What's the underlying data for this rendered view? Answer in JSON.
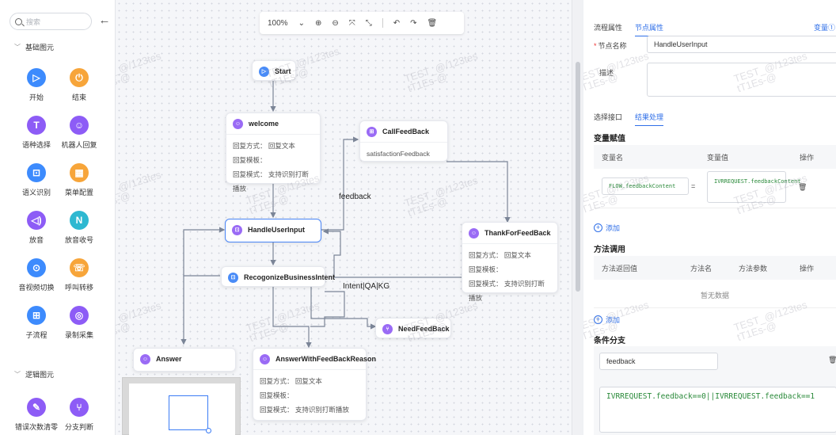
{
  "palette": {
    "search_placeholder": "搜索",
    "section_basic": "基础图元",
    "section_logic": "逻辑图元",
    "items": [
      {
        "label": "开始",
        "icon": "play-icon"
      },
      {
        "label": "结束",
        "icon": "power-icon"
      },
      {
        "label": "语种选择",
        "icon": "text-T-icon"
      },
      {
        "label": "机器人回复",
        "icon": "robot-icon"
      },
      {
        "label": "语义识别",
        "icon": "scan-face-icon"
      },
      {
        "label": "菜单配置",
        "icon": "grid-menu-icon"
      },
      {
        "label": "放音",
        "icon": "speaker-icon"
      },
      {
        "label": "放音收号",
        "icon": "keypad-icon"
      },
      {
        "label": "音视频切换",
        "icon": "av-switch-icon"
      },
      {
        "label": "呼叫转移",
        "icon": "call-transfer-icon"
      },
      {
        "label": "子流程",
        "icon": "subflow-icon"
      },
      {
        "label": "录制采集",
        "icon": "record-icon"
      },
      {
        "label": "错误次数清零",
        "icon": "eraser-icon"
      },
      {
        "label": "分支判断",
        "icon": "branch-icon"
      }
    ]
  },
  "toolbar": {
    "zoom": "100%"
  },
  "nodes": {
    "start": "Start",
    "welcome": {
      "title": "welcome",
      "lines": [
        "回复方式：  回复文本",
        "回复模板：",
        "回复模式：  支持识别打断播放"
      ]
    },
    "callfeedback": {
      "title": "CallFeedBack",
      "body": "satisfactionFeedback"
    },
    "handleuserinput": "HandleUserInput",
    "thankforfeedback": {
      "title": "ThankForFeedBack",
      "lines": [
        "回复方式：  回复文本",
        "回复模板：",
        "回复模式：  支持识别打断播放"
      ]
    },
    "recognize": "RecogonizeBusinessIntent",
    "needfeedback": "NeedFeedBack",
    "answer": "Answer",
    "answerwithfeedback": {
      "title": "AnswerWithFeedBackReason",
      "lines": [
        "回复方式：  回复文本",
        "回复模板：",
        "回复模式：  支持识别打断播放"
      ]
    }
  },
  "edge_labels": {
    "feedback": "feedback",
    "intent": "Intent|QA|KG"
  },
  "watermark": "TEST_@/123tes\ntT1Es-@",
  "panel": {
    "tabs": [
      "流程属性",
      "节点属性"
    ],
    "active_tab": "节点属性",
    "top_right": "变量①",
    "node_name_label": "节点名称",
    "node_name_value": "HandleUserInput",
    "desc_label": "描述",
    "subtabs": [
      "选择接口",
      "结果处理"
    ],
    "active_subtab": "结果处理",
    "var_section": "变量赋值",
    "var_headers": [
      "变量名",
      "变量值",
      "操作"
    ],
    "var_row": {
      "name": "FLOW.feedbackContent",
      "eq": "=",
      "value": "IVRREQUEST.feedbackContent"
    },
    "add": "添加",
    "method_section": "方法调用",
    "method_headers": [
      "方法返回值",
      "方法名",
      "方法参数",
      "操作"
    ],
    "no_data": "暂无数据",
    "cond_section": "条件分支",
    "cond_name": "feedback",
    "cond_expr": "IVRREQUEST.feedback==0||IVRREQUEST.feedback==1"
  }
}
